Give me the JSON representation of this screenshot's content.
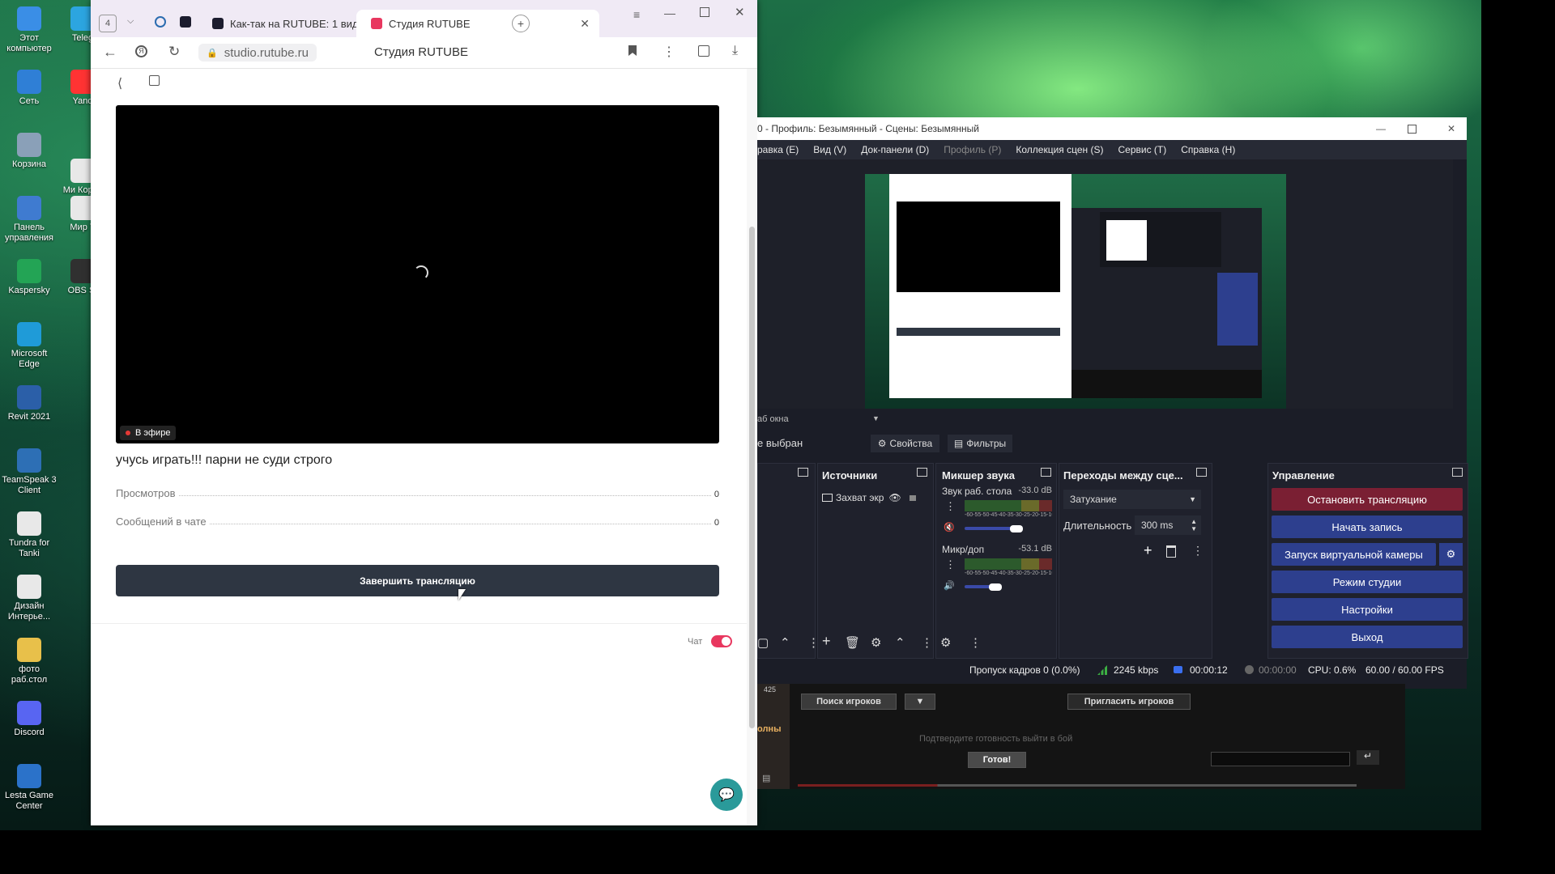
{
  "desktop": {
    "icons": [
      {
        "label": "Этот компьютер",
        "icon": "computer-icon",
        "color": "#3a8ee6"
      },
      {
        "label": "Сеть",
        "icon": "network-icon",
        "color": "#2f7fd6"
      },
      {
        "label": "Корзина",
        "icon": "recycle-bin-icon",
        "color": "#8aa0b8"
      },
      {
        "label": "Панель управления",
        "icon": "control-panel-icon",
        "color": "#3f7bd0"
      },
      {
        "label": "Kaspersky",
        "icon": "kaspersky-icon",
        "color": "#23a455"
      },
      {
        "label": "Microsoft Edge",
        "icon": "edge-icon",
        "color": "#1f9bd8"
      },
      {
        "label": "Revit 2021",
        "icon": "revit-icon",
        "color": "#2b5fa8"
      },
      {
        "label": "TeamSpeak 3 Client",
        "icon": "teamspeak-icon",
        "color": "#2d6fb5"
      },
      {
        "label": "Tundra for Tanki",
        "icon": "file-icon",
        "color": "#e8e8e8"
      },
      {
        "label": "Дизайн Интерье...",
        "icon": "file-icon",
        "color": "#e8e8e8"
      },
      {
        "label": "фото раб.стол",
        "icon": "folder-icon",
        "color": "#e8c04a"
      },
      {
        "label": "Discord",
        "icon": "discord-icon",
        "color": "#5865f2"
      },
      {
        "label": "Lesta Game Center",
        "icon": "lesta-icon",
        "color": "#2b72c9"
      }
    ],
    "icons_col2": [
      {
        "label": "Teleg",
        "icon": "telegram-icon",
        "color": "#2ca5e0"
      },
      {
        "label": "Yand",
        "icon": "yandex-icon",
        "color": "#ff3333"
      },
      {
        "label": "Ми Корас",
        "icon": "file-icon",
        "color": "#e8e8e8"
      },
      {
        "label": "Мир Т",
        "icon": "file-icon",
        "color": "#e8e8e8"
      },
      {
        "label": "OBS St",
        "icon": "obs-icon",
        "color": "#303030"
      }
    ]
  },
  "browser": {
    "tab_count": "4",
    "tabs": [
      {
        "title": "Как-так на RUTUBE: 1 вид",
        "icon": "rutube-icon"
      },
      {
        "title": "Студия RUTUBE",
        "icon": "rutube-studio-icon"
      }
    ],
    "url": "studio.rutube.ru",
    "page_title": "Студия RUTUBE",
    "live_badge": "В эфире",
    "stream_title": "учусь играть!!! парни не суди строго",
    "stats": [
      {
        "label": "Просмотров",
        "value": "0"
      },
      {
        "label": "Сообщений в чате",
        "value": "0"
      }
    ],
    "end_button": "Завершить трансляцию",
    "chat_label": "Чат",
    "chat_toggle_on": true
  },
  "obs": {
    "title": "0 - Профиль: Безымянный - Сцены: Безымянный",
    "menu": [
      "равка (E)",
      "Вид (V)",
      "Док-панели (D)",
      "Профиль (P)",
      "Коллекция сцен (S)",
      "Сервис (T)",
      "Справка (H)"
    ],
    "source_label": "аб окна",
    "not_selected": "е выбран",
    "properties_btn": "Свойства",
    "filters_btn": "Фильтры",
    "docks": {
      "sources": "Источники",
      "mixer": "Микшер звука",
      "transitions": "Переходы между сце...",
      "controls": "Управление"
    },
    "source_item": "Захват экр",
    "mixer": [
      {
        "name": "Звук раб. стола",
        "db": "-33.0 dB",
        "level": 0.0,
        "muted": true
      },
      {
        "name": "Микр/доп",
        "db": "-53.1 dB",
        "level": 0.0,
        "muted": false
      }
    ],
    "meter_scale": "-60-55-50-45-40-35-30-25-20-15-10 -5  0",
    "transition_select": "Затухание",
    "duration_label": "Длительность",
    "duration_value": "300 ms",
    "controls": [
      "Остановить трансляцию",
      "Начать запись",
      "Запуск виртуальной камеры",
      "Режим студии",
      "Настройки",
      "Выход"
    ],
    "status": {
      "dropped": "Пропуск кадров 0 (0.0%)",
      "bitrate": "2245 kbps",
      "stream_time": "00:00:12",
      "rec_time": "00:00:00",
      "cpu": "CPU: 0.6%",
      "fps": "60.00 / 60.00 FPS"
    }
  },
  "game": {
    "search_players": "Поиск игроков",
    "invite_players": "Пригласить игроков",
    "confirm_text": "Подтвердите готовность выйти в бой",
    "ready_btn": "Готов!",
    "side_label": "олны",
    "count_label": "425"
  }
}
